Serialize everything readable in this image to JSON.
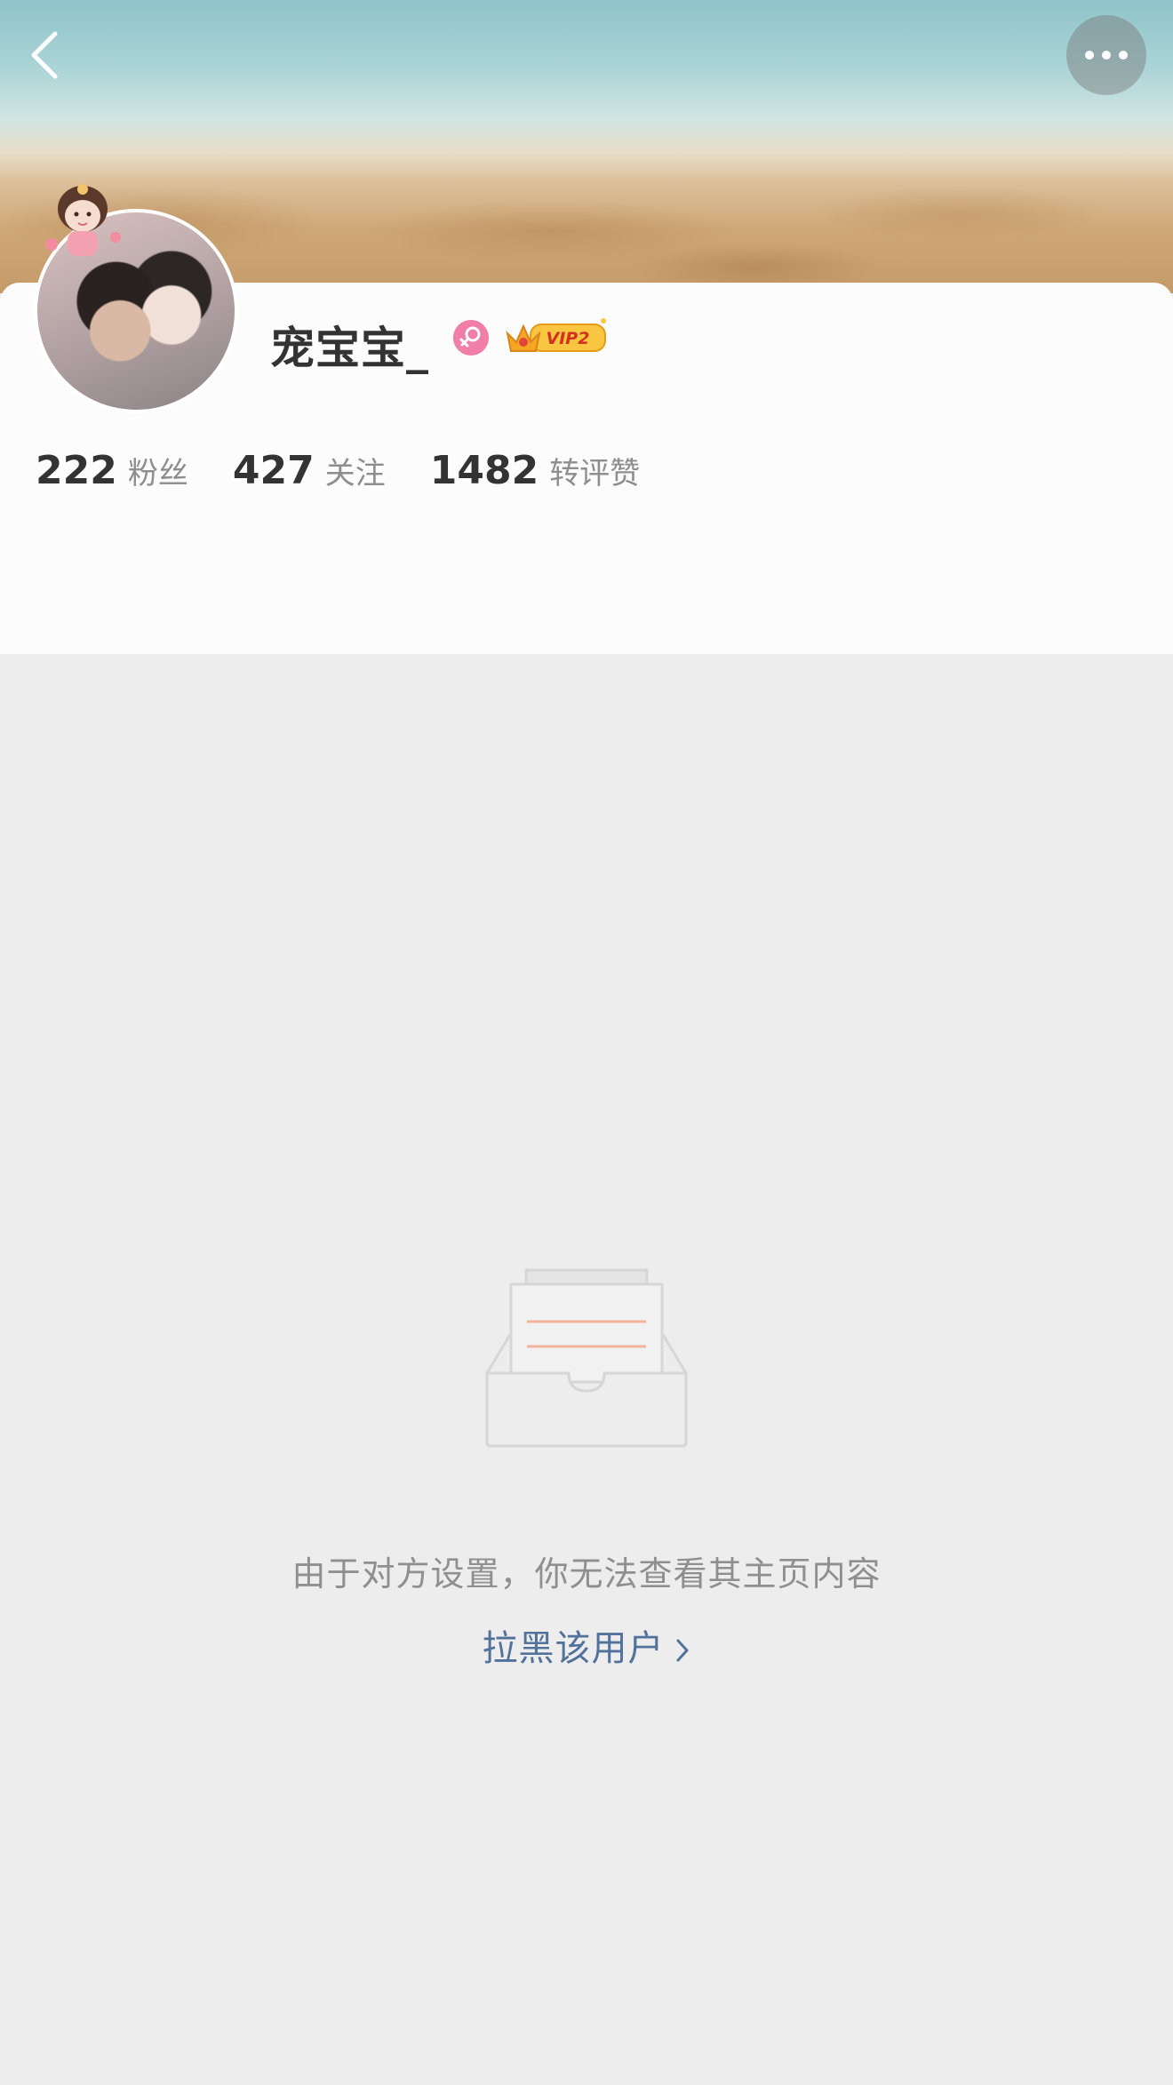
{
  "header": {
    "back_icon": "chevron-left-icon",
    "more_icon": "more-dots-icon"
  },
  "profile": {
    "username": "宠宝宝_",
    "gender_icon": "female-icon",
    "vip_badge": "VIP2",
    "stats": [
      {
        "value": "222",
        "label": "粉丝"
      },
      {
        "value": "427",
        "label": "关注"
      },
      {
        "value": "1482",
        "label": "转评赞"
      }
    ]
  },
  "empty_state": {
    "illustration": "empty-inbox-icon",
    "message": "由于对方设置，你无法查看其主页内容",
    "block_link": "拉黑该用户",
    "link_icon": "chevron-right-icon"
  },
  "colors": {
    "background": "#ededed",
    "card": "#fcfcfc",
    "link": "#52729c",
    "muted_text": "#8f8f8f",
    "female": "#f07ea6",
    "vip_gold": "#f5b82e"
  }
}
